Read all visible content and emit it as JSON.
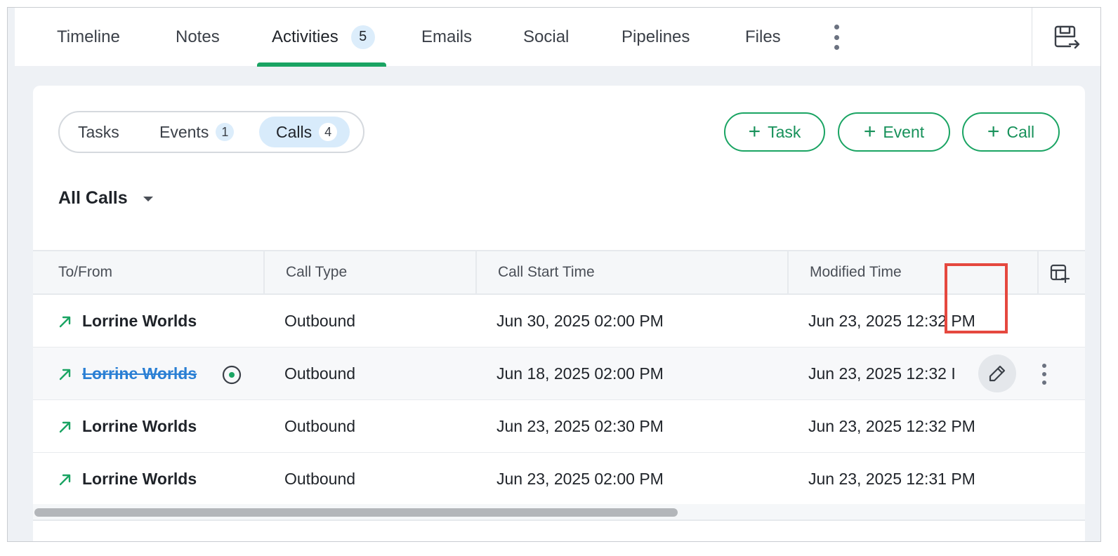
{
  "top_tabs": [
    {
      "label": "Timeline"
    },
    {
      "label": "Notes"
    },
    {
      "label": "Activities",
      "count": "5"
    },
    {
      "label": "Emails"
    },
    {
      "label": "Social"
    },
    {
      "label": "Pipelines"
    },
    {
      "label": "Files"
    }
  ],
  "active_tab": "Activities",
  "segments": [
    {
      "label": "Tasks"
    },
    {
      "label": "Events",
      "count": "1"
    },
    {
      "label": "Calls",
      "count": "4"
    }
  ],
  "active_segment": "Calls",
  "buttons": {
    "add_task": "Task",
    "add_event": "Event",
    "add_call": "Call",
    "plus": "+"
  },
  "view": {
    "label": "All Calls"
  },
  "table": {
    "columns": [
      "To/From",
      "Call Type",
      "Call Start Time",
      "Modified Time"
    ],
    "rows": [
      {
        "name": "Lorrine Worlds",
        "type": "Outbound",
        "start": "Jun 30, 2025 02:00 PM",
        "modified": "Jun 23, 2025 12:32 PM"
      },
      {
        "name": "Lorrine Worlds",
        "type": "Outbound",
        "start": "Jun 18, 2025 02:00 PM",
        "modified": "Jun 23, 2025 12:32 I"
      },
      {
        "name": "Lorrine Worlds",
        "type": "Outbound",
        "start": "Jun 23, 2025 02:30 PM",
        "modified": "Jun 23, 2025 12:32 PM"
      },
      {
        "name": "Lorrine Worlds",
        "type": "Outbound",
        "start": "Jun 23, 2025 02:00 PM",
        "modified": "Jun 23, 2025 12:31 PM"
      }
    ]
  },
  "icons": {
    "direction": "outgoing-arrow-icon",
    "eye": "eye-icon",
    "edit": "pencil-icon",
    "more": "kebab-icon",
    "columns": "table-columns-icon",
    "export": "export-icon"
  },
  "colors": {
    "accent_green": "#1aa463",
    "badge_blue": "#dcedfb",
    "link_blue": "#2a7fd4",
    "highlight_red": "#e5483f"
  }
}
